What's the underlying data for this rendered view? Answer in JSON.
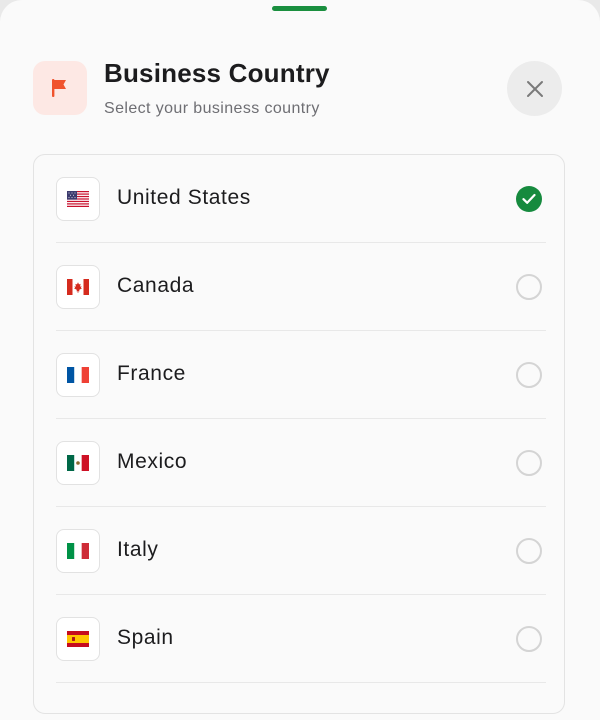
{
  "sheet": {
    "title": "Business Country",
    "subtitle": "Select your business country",
    "header_icon": "flag-icon",
    "close_icon": "close-icon"
  },
  "countries": [
    {
      "name": "United States",
      "flag": "us-flag-icon",
      "selected": true
    },
    {
      "name": "Canada",
      "flag": "canada-flag-icon",
      "selected": false
    },
    {
      "name": "France",
      "flag": "france-flag-icon",
      "selected": false
    },
    {
      "name": "Mexico",
      "flag": "mexico-flag-icon",
      "selected": false
    },
    {
      "name": "Italy",
      "flag": "italy-flag-icon",
      "selected": false
    },
    {
      "name": "Spain",
      "flag": "spain-flag-icon",
      "selected": false
    }
  ],
  "colors": {
    "accent": "#168a3e",
    "header_icon_bg": "#fde8e4",
    "header_icon_fg": "#f0532d"
  }
}
